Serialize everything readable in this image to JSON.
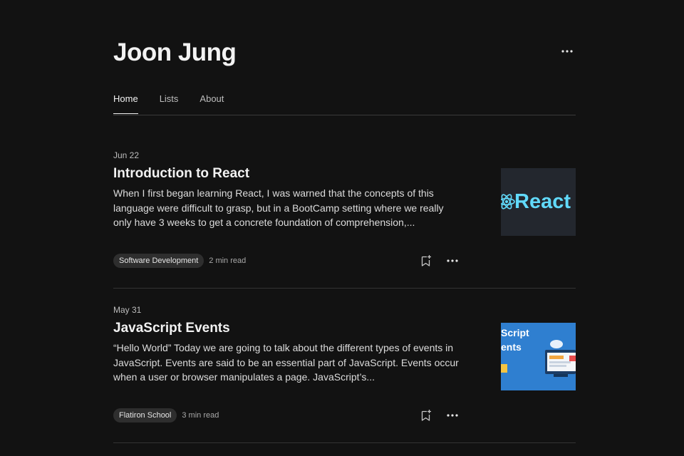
{
  "profile": {
    "name": "Joon Jung"
  },
  "tabs": [
    {
      "label": "Home",
      "active": true
    },
    {
      "label": "Lists",
      "active": false
    },
    {
      "label": "About",
      "active": false
    }
  ],
  "articles": [
    {
      "date": "Jun 22",
      "title": "Introduction to React",
      "excerpt": "When I first began learning React, I was warned that the concepts of this language were difficult to grasp, but in a BootCamp setting where we really only have 3 weeks to get a concrete foundation of comprehension,...",
      "tag": "Software Development",
      "read_time": "2 min read",
      "thumb_text": "React"
    },
    {
      "date": "May 31",
      "title": "JavaScript Events",
      "excerpt": "“Hello World” Today we are going to talk about the different types of events in JavaScript. Events are said to be an essential part of JavaScript. Events occur when a user or browser manipulates a page. JavaScript’s...",
      "tag": "Flatiron School",
      "read_time": "3 min read",
      "thumb_text_1": "Script",
      "thumb_text_2": "ents"
    }
  ],
  "colors": {
    "background": "#121212",
    "react_blue": "#61dafb",
    "js_blue": "#2f7fd0"
  }
}
